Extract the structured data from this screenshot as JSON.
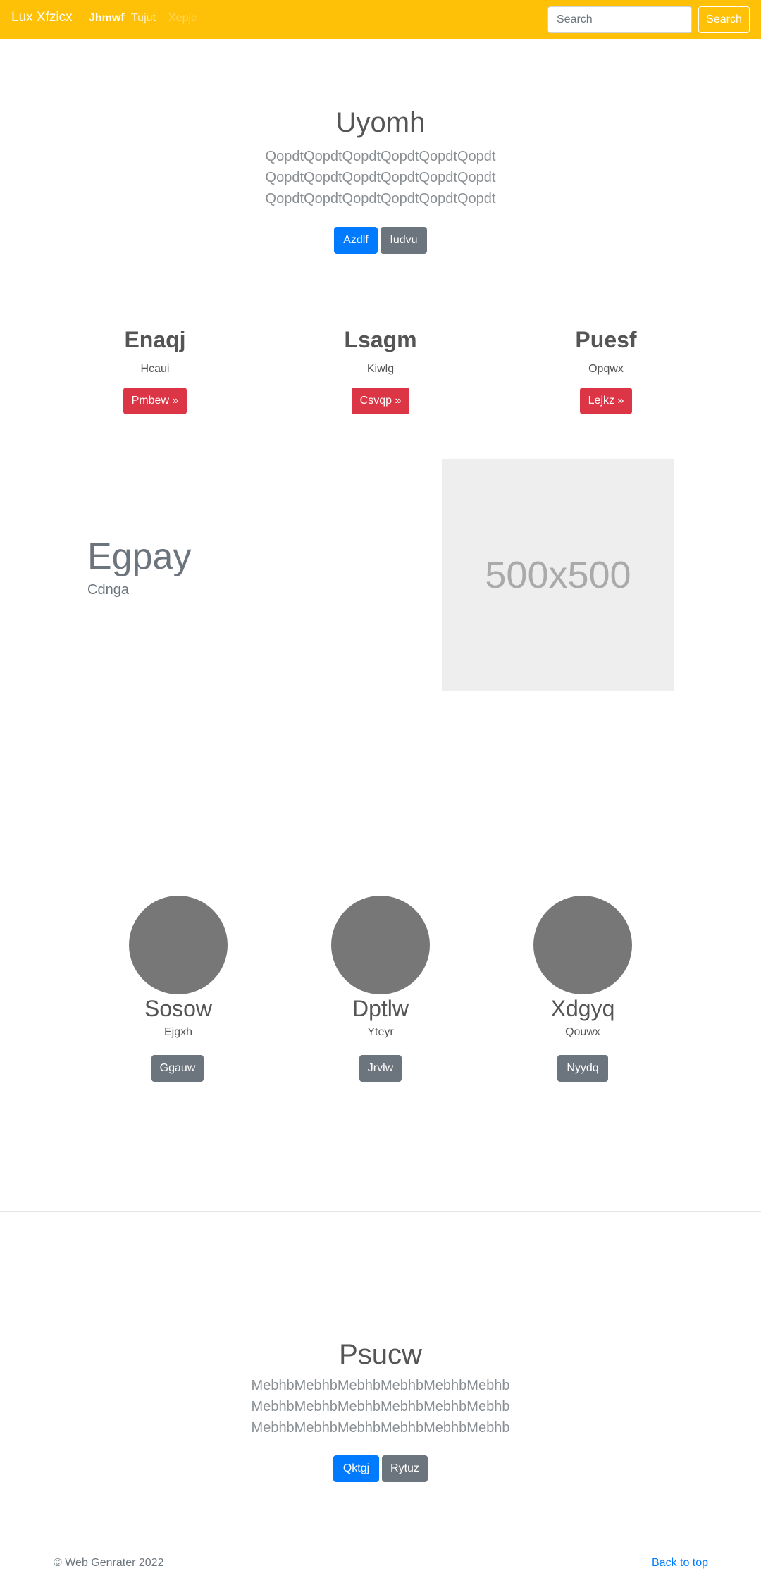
{
  "navbar": {
    "brand": "Lux Xfzicx",
    "links": [
      "Jhmwf",
      "Tujut",
      "Xepjc"
    ],
    "search_placeholder": "Search",
    "search_button": "Search",
    "background": "#ffc107"
  },
  "hero": {
    "title": "Uyomh",
    "lines": [
      "QopdtQopdtQopdtQopdtQopdtQopdt",
      "QopdtQopdtQopdtQopdtQopdtQopdt",
      "QopdtQopdtQopdtQopdtQopdtQopdt"
    ],
    "primary_button": "Azdlf",
    "secondary_button": "Iudvu"
  },
  "features": [
    {
      "title": "Enaqj",
      "text": "Hcaui",
      "button": "Pmbew »"
    },
    {
      "title": "Lsagm",
      "text": "Kiwlg",
      "button": "Csvqp »"
    },
    {
      "title": "Puesf",
      "text": "Opqwx",
      "button": "Lejkz »"
    }
  ],
  "featurette": {
    "title": "Egpay",
    "subtitle": "Cdnga",
    "image_label": "500x500"
  },
  "team": [
    {
      "name": "Sosow",
      "text": "Ejgxh",
      "button": "Ggauw"
    },
    {
      "name": "Dptlw",
      "text": "Yteyr",
      "button": "Jrvlw"
    },
    {
      "name": "Xdgyq",
      "text": "Qouwx",
      "button": "Nyydq"
    }
  ],
  "closing": {
    "title": "Psucw",
    "lines": [
      "MebhbMebhbMebhbMebhbMebhbMebhb",
      "MebhbMebhbMebhbMebhbMebhbMebhb",
      "MebhbMebhbMebhbMebhbMebhbMebhb"
    ],
    "primary_button": "Qktgj",
    "secondary_button": "Rytuz"
  },
  "footer": {
    "copyright": "© Web Genrater 2022",
    "back_to_top": "Back to top"
  },
  "colors": {
    "primary": "#007bff",
    "secondary": "#6c757d",
    "danger": "#dc3545",
    "avatar": "#777777",
    "placeholder": "#eeeeee"
  }
}
